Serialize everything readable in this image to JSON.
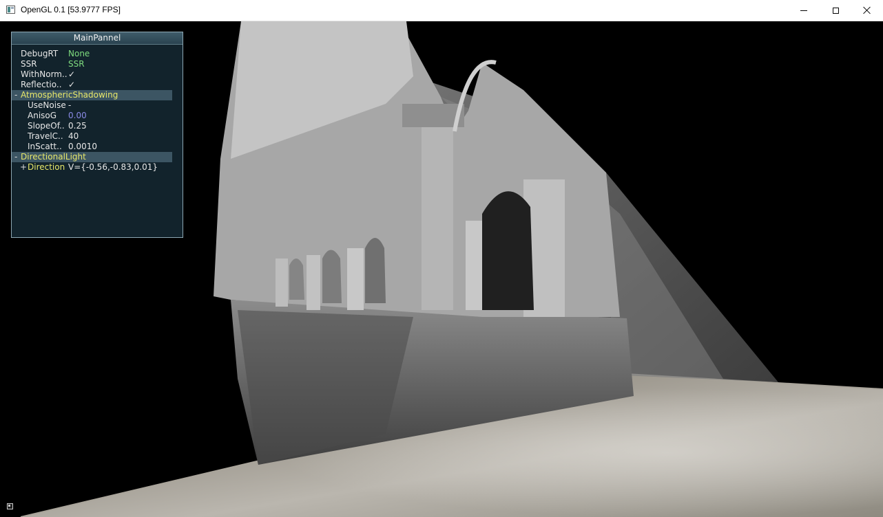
{
  "window": {
    "title": "OpenGL 0.1 [53.9777 FPS]"
  },
  "panel": {
    "title": "MainPannel",
    "rows": [
      {
        "label": "DebugRT",
        "value": "None"
      },
      {
        "label": "SSR",
        "value": "SSR"
      },
      {
        "label": "WithNorm..",
        "value": "✓"
      },
      {
        "label": "Reflectio..",
        "value": "✓"
      }
    ],
    "atmospheric": {
      "toggle": "-",
      "title": "AtmosphericShadowing",
      "rows": [
        {
          "label": "UseNoise",
          "value": "-"
        },
        {
          "label": "AnisoG",
          "value": "0.00"
        },
        {
          "label": "SlopeOf..",
          "value": "0.25"
        },
        {
          "label": "TravelC..",
          "value": "40"
        },
        {
          "label": "InScatt..",
          "value": "0.0010"
        }
      ]
    },
    "directional": {
      "toggle": "-",
      "title": "DirectionalLight",
      "direction": {
        "expand": "+",
        "label": "Direction",
        "value": "V={-0.56,-0.83,0.01}"
      }
    }
  },
  "colors": {
    "background": "#000000",
    "panel_bg": "#142832",
    "value_green": "#7fdc7f",
    "value_blue": "#8a8ae6",
    "label_yellow": "#e8e86a"
  }
}
